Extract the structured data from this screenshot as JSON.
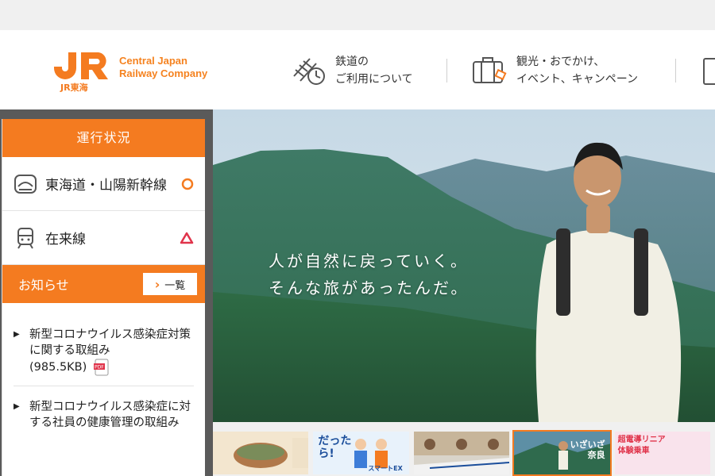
{
  "header": {
    "logo_mark_text": "JR東海",
    "logo_text_line1": "Central Japan",
    "logo_text_line2": "Railway Company",
    "nav": [
      {
        "label": "鉄道の\nご利用について",
        "icon": "railway-clock-icon"
      },
      {
        "label": "観光・おでかけ、\nイベント、キャンペーン",
        "icon": "suitcase-icon"
      },
      {
        "label": "",
        "icon": "document-icon"
      }
    ]
  },
  "hero": {
    "copy_line1": "人が自然に戻っていく。",
    "copy_line2": "そんな旅があったんだ。"
  },
  "status": {
    "title": "運行状況",
    "lines": [
      {
        "name": "東海道・山陽新幹線",
        "status": "circle",
        "color": "#f47b20"
      },
      {
        "name": "在来線",
        "status": "triangle",
        "color": "#e0344b"
      }
    ]
  },
  "news": {
    "title": "お知らせ",
    "more_label": "一覧",
    "items": [
      {
        "text": "新型コロナウイルス感染症対策に関する取組み",
        "size": "(985.5KB)",
        "pdf_label": "PDF"
      },
      {
        "text": "新型コロナウイルス感染症に対する社員の健康管理の取組み"
      }
    ]
  },
  "thumbnails": [
    {
      "name": "food-banner"
    },
    {
      "name": "dattara-banner",
      "label": "だった\nら!",
      "sub": "スマートEX"
    },
    {
      "name": "people-banner"
    },
    {
      "name": "nara-banner",
      "label": "いざいざ\n奈良"
    },
    {
      "name": "linear-banner",
      "label": "超電導リニア\n体験乗車"
    }
  ],
  "colors": {
    "accent": "#f47b20",
    "warning": "#e0344b"
  }
}
